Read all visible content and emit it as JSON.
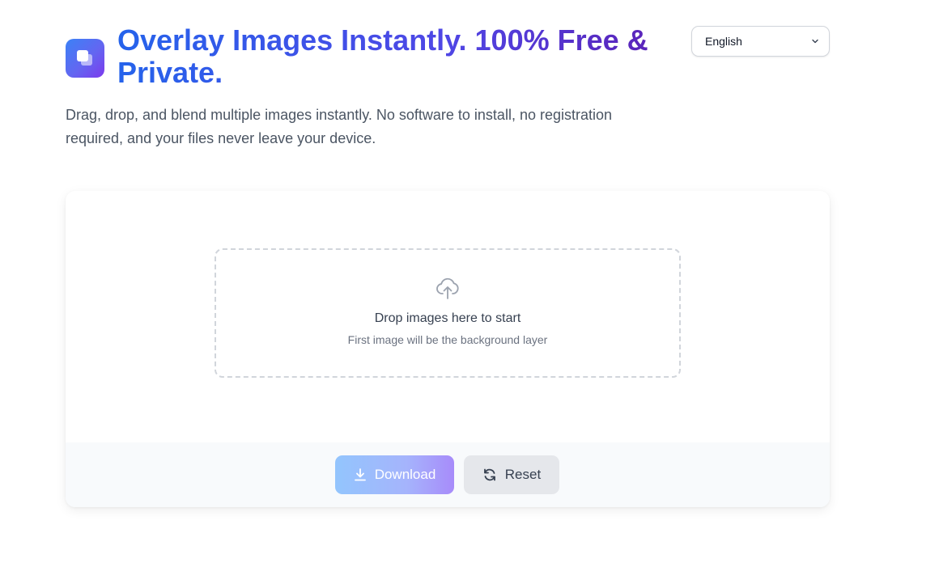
{
  "header": {
    "title": "Overlay Images Instantly. 100% Free & Private.",
    "subtitle": "Drag, drop, and blend multiple images instantly. No software to install, no registration required, and your files never leave your device.",
    "logo_icon": "layers-icon"
  },
  "language": {
    "selected": "English",
    "icon": "chevron-down-icon"
  },
  "dropzone": {
    "icon": "cloud-upload-icon",
    "main_text": "Drop images here to start",
    "sub_text": "First image will be the background layer"
  },
  "actions": {
    "download_label": "Download",
    "download_icon": "download-icon",
    "reset_label": "Reset",
    "reset_icon": "refresh-icon"
  },
  "colors": {
    "title_gradient_start": "#2563eb",
    "title_gradient_end": "#5b21b6",
    "download_gradient_start": "#93c5fd",
    "download_gradient_end": "#a78bfa",
    "reset_bg": "#e5e7eb"
  }
}
